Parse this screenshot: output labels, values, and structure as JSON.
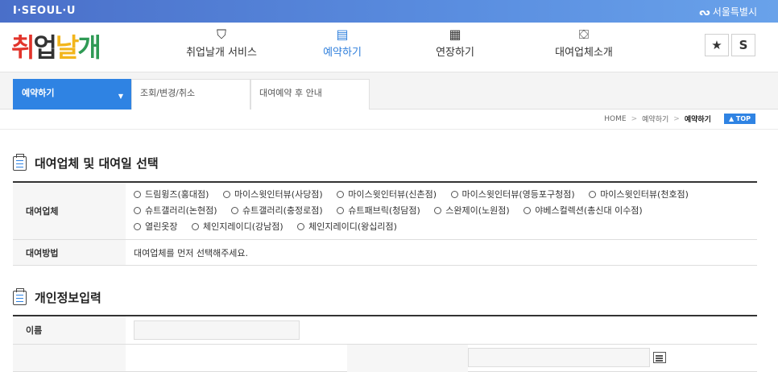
{
  "topbar": {
    "brand": "I·SEOUL·U",
    "seoul_logo": "서울특별시",
    "seoul_mark_icon": "seoul-logo-mark-icon"
  },
  "logo": {
    "p1": "취",
    "p2": "업",
    "p3": "날",
    "p4": "개"
  },
  "nav": [
    {
      "label": "취업날개 서비스",
      "icon": "suit-icon"
    },
    {
      "label": "예약하기",
      "icon": "clipboard-icon",
      "active": true
    },
    {
      "label": "연장하기",
      "icon": "calendar-icon"
    },
    {
      "label": "대여업체소개",
      "icon": "briefcase-icon"
    }
  ],
  "header_buttons": {
    "favorite": "★",
    "s_button": "S"
  },
  "tabs": [
    {
      "label": "예약하기",
      "active": true
    },
    {
      "label": "조회/변경/취소"
    },
    {
      "label": "대여예약 후 안내"
    }
  ],
  "breadcrumb": {
    "home": "HOME",
    "sep": ">",
    "level1": "예약하기",
    "current": "예약하기",
    "top_button": "▲ TOP"
  },
  "section1": {
    "title": "대여업체 및 대여일 선택",
    "vendor_label": "대여업체",
    "vendor_rows": [
      [
        "드림윙즈(홍대점)",
        "마이스윗인터뷰(사당점)",
        "마이스윗인터뷰(신촌점)",
        "마이스윗인터뷰(영등포구청점)",
        "마이스윗인터뷰(천호점)"
      ],
      [
        "슈트갤러리(논현점)",
        "슈트갤러리(충정로점)",
        "슈트패브릭(청담점)",
        "스완제이(노원점)",
        "야베스컬렉션(총신대 이수점)"
      ],
      [
        "열린옷장",
        "체인지레이디(강남점)",
        "체인지레이디(왕십리점)"
      ]
    ],
    "method_label": "대여방법",
    "method_value": "대여업체를 먼저 선택해주세요."
  },
  "section2": {
    "title": "개인정보입력",
    "name_label": "이름"
  }
}
